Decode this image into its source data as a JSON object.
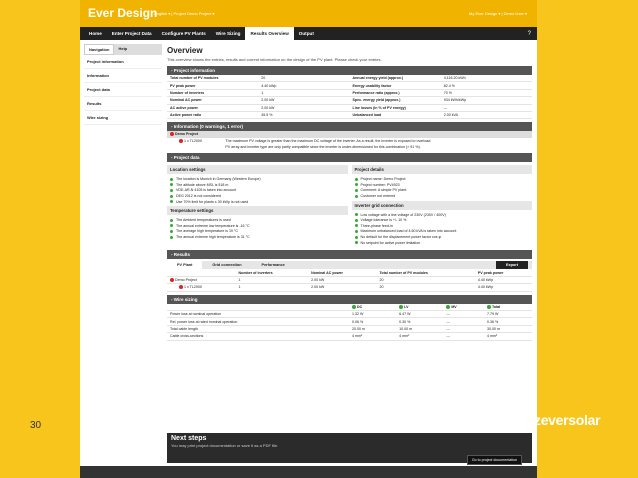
{
  "slide_number": "30",
  "brand": "zeversolar",
  "app": {
    "logo": "Ever Design",
    "top_links": "English ▾  |  Project Demo Project ▾",
    "user_links": "My Ever Design ▾  |  Demo User ▾"
  },
  "nav": {
    "tabs": [
      "Home",
      "Enter Project Data",
      "Configure PV Plants",
      "Wire Sizing",
      "Results Overview",
      "Output"
    ],
    "active": 4,
    "help_icon": "?"
  },
  "sidebar": {
    "tabs": [
      "Navigation",
      "Help"
    ],
    "items": [
      "Project information",
      "Information",
      "Project data",
      "Results",
      "Wire sizing"
    ]
  },
  "page": {
    "title": "Overview",
    "description": "This overview shows the entries, results and current information on the design of the PV plant. Please check your entries."
  },
  "project_info": {
    "header": "- Project information",
    "rows": [
      [
        "Total number of PV modules",
        "20",
        "Annual energy yield (approx.)",
        "4,116.20 kWh"
      ],
      [
        "PV peak power",
        "4.40 kWp",
        "Energy usability factor",
        "82.4 %"
      ],
      [
        "Number of inverters",
        "1",
        "Performance ratio (approx.)",
        "70 %"
      ],
      [
        "Nominal AC power",
        "2.00 kW",
        "Spec. energy yield (approx.)",
        "934 kWh/kWp"
      ],
      [
        "AC active power",
        "2.00 kW",
        "Line losses (in % of PV energy)",
        "---"
      ],
      [
        "Active power ratio",
        "45.5 %",
        "Unbalanced load",
        "2.00 kVA"
      ]
    ]
  },
  "information": {
    "header": "- Information (0 warnings, 1 error)",
    "project": "Demo Project",
    "item": "1 x TL2000",
    "msg1": "The maximum PV voltage is greater than the maximum DC voltage of the inverter. As a result, the inverter is exposed to overload.",
    "msg2": "PV array and inverter type are only partly compatible since the inverter is under-dimensioned for this combination (> 91 %)."
  },
  "project_data": {
    "header": "- Project data",
    "location": {
      "title": "Location settings",
      "items": [
        "The location is Munich in Germany (Western Europe)",
        "The altitude above MSL is 518 m",
        "VDE-AR-N 4105 is taken into account",
        "DEG 2012 is not considered",
        "Use 70% limit for plants ≤ 30 kWp is not used"
      ]
    },
    "details": {
      "title": "Project details",
      "items": [
        "Project name: Demo Project",
        "Project number: PV4923",
        "Comment: A simple PV plant.",
        "Customer not entered"
      ]
    },
    "temperature": {
      "title": "Temperature settings",
      "items": [
        "The Ambient temperatures is used",
        "The annual extreme low temperature is -16 °C",
        "The average high temperature is 19 °C",
        "The annual extreme high temperature is 31 °C"
      ]
    },
    "grid": {
      "title": "Inverter grid connection",
      "items": [
        "Low voltage with a line voltage of 230V (230V / 400V)",
        "Voltage tolerance is +/- 10 %",
        "Three-phase feed-in",
        "Maximum unbalanced load of 4.60 kVA is taken into account",
        "No default for the displacement power factor cos φ",
        "No setpoint for active power limitation"
      ]
    }
  },
  "results": {
    "header": "- Results",
    "tabs": [
      "PV Plant",
      "Grid connection",
      "Performance"
    ],
    "export": "Export",
    "columns": [
      "",
      "Number of inverters",
      "Nominal AC power",
      "Total number of PV modules",
      "PV peak power"
    ],
    "rows": [
      [
        "Demo Project",
        "1",
        "2.00 kW",
        "20",
        "4.40 kWp"
      ],
      [
        "1 x TL2000",
        "1",
        "2.00 kW",
        "20",
        "4.40 kWp"
      ]
    ]
  },
  "wire": {
    "header": "- Wire sizing",
    "columns": [
      "",
      "DC",
      "LV",
      "MV",
      "Total"
    ],
    "rows": [
      [
        "Power loss at nominal operation",
        "1.32 W",
        "6.47 W",
        "---",
        "7.79 W"
      ],
      [
        "Rel. power loss at rated nominal operation",
        "0.06 %",
        "0.30 %",
        "---",
        "0.36 %"
      ],
      [
        "Total cable length",
        "20.00 m",
        "10.00 m",
        "---",
        "30.00 m"
      ],
      [
        "Cable cross-sections",
        "4 mm²",
        "4 mm²",
        "---",
        "4 mm²"
      ]
    ]
  },
  "next": {
    "title": "Next steps",
    "desc": "You may print project documentation or save it as a PDF file.",
    "button": "Go to project documentation"
  }
}
